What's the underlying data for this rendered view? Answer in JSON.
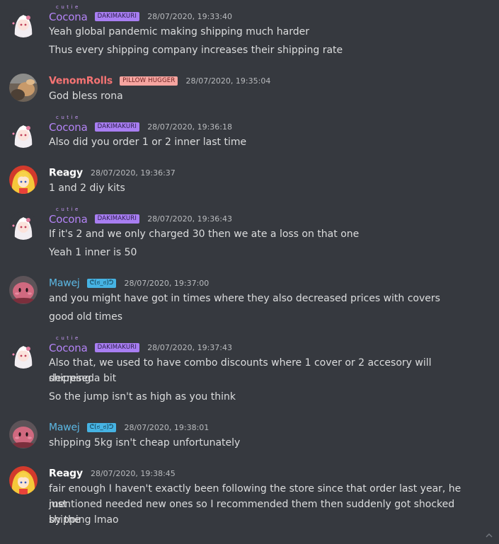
{
  "colors": {
    "background": "#36393f",
    "cocona": "#b383f5",
    "venomrolls": "#f47373",
    "reagy": "#ffffff",
    "mawej": "#5cb8e4",
    "dakimakuri_badge": "#a87ef2",
    "pillow_badge": "#f6a5a0",
    "mawej_badge": "#46b3e3"
  },
  "messages": [
    {
      "id": "m1",
      "author": "Cocona",
      "author_tag": "cutie",
      "badge": "DAKIMAKURI",
      "timestamp": "28/07/2020, 19:33:40",
      "avatar": "anime-girl-white-hair-avatar",
      "lines": [
        "Yeah global pandemic making shipping much harder",
        "Thus every shipping company increases their shipping rate"
      ]
    },
    {
      "id": "m2",
      "author": "VenomRolls",
      "badge": "PILLOW HUGGER",
      "timestamp": "28/07/2020, 19:35:04",
      "avatar": "blurry-photo-avatar",
      "lines": [
        "God bless rona"
      ]
    },
    {
      "id": "m3",
      "author": "Cocona",
      "author_tag": "cutie",
      "badge": "DAKIMAKURI",
      "timestamp": "28/07/2020, 19:36:18",
      "avatar": "anime-girl-white-hair-avatar",
      "lines": [
        "Also did you order 1 or 2 inner last time"
      ]
    },
    {
      "id": "m4",
      "author": "Reagy",
      "timestamp": "28/07/2020, 19:36:37",
      "avatar": "anime-girl-blonde-avatar",
      "lines": [
        "1 and 2 diy kits"
      ]
    },
    {
      "id": "m5",
      "author": "Cocona",
      "author_tag": "cutie",
      "badge": "DAKIMAKURI",
      "timestamp": "28/07/2020, 19:36:43",
      "avatar": "anime-girl-white-hair-avatar",
      "lines": [
        "If it's 2 and we only charged 30 then we ate a loss on that one",
        "Yeah 1 inner is 50"
      ]
    },
    {
      "id": "m6",
      "author": "Mawej",
      "badge": "ᕦ(ಠ_ಠ)ᕤ",
      "timestamp": "28/07/2020, 19:37:00",
      "avatar": "pink-blob-avatar",
      "lines": [
        "and you might have got in times where they also decreased prices with covers",
        "good old times"
      ]
    },
    {
      "id": "m7",
      "author": "Cocona",
      "author_tag": "cutie",
      "badge": "DAKIMAKURI",
      "timestamp": "28/07/2020, 19:37:43",
      "avatar": "anime-girl-white-hair-avatar",
      "lines": [
        "Also that, we used to have combo discounts where 1 cover or 2 accesory will decresed",
        "shipping a bit",
        "So the jump isn't as high as you think"
      ]
    },
    {
      "id": "m8",
      "author": "Mawej",
      "badge": "ᕦ(ಠ_ಠ)ᕤ",
      "timestamp": "28/07/2020, 19:38:01",
      "avatar": "pink-blob-avatar",
      "lines": [
        "shipping 5kg isn't cheap unfortunately"
      ]
    },
    {
      "id": "m9",
      "author": "Reagy",
      "timestamp": "28/07/2020, 19:38:45",
      "avatar": "anime-girl-blonde-avatar",
      "lines": [
        "fair enough I haven't exactly been following the store since that order last year, he just",
        "mentioned needed new ones so I recommended them then suddenly got shocked by the",
        "shipping lmao"
      ]
    }
  ],
  "scroll_icon": "chevron-up-icon"
}
